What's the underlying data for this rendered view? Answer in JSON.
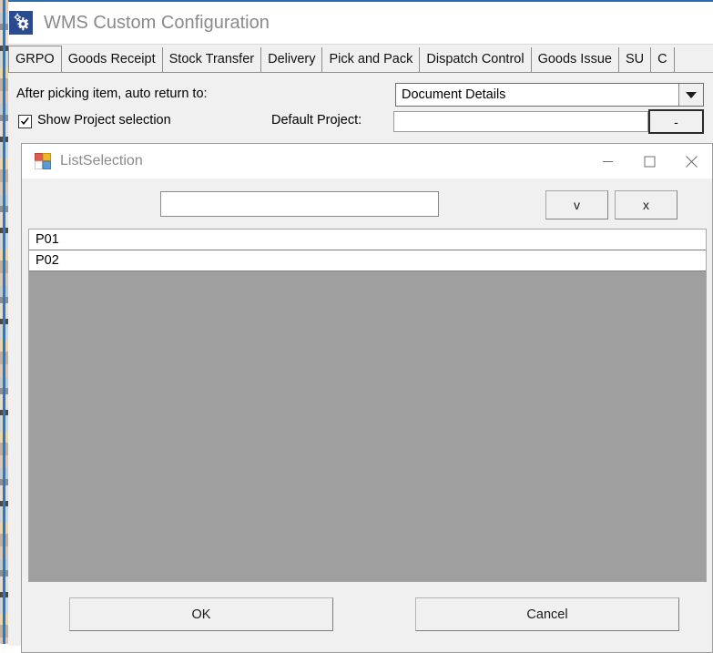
{
  "app": {
    "title": "WMS Custom Configuration",
    "icon": "gears-icon",
    "accent_color": "#2b4b8f",
    "title_color": "#8a8a8a",
    "top_border_color": "#2c6ca8"
  },
  "tabs": [
    {
      "label": "GRPO",
      "active": true
    },
    {
      "label": "Goods Receipt",
      "active": false
    },
    {
      "label": "Stock Transfer",
      "active": false
    },
    {
      "label": "Delivery",
      "active": false
    },
    {
      "label": "Pick and Pack",
      "active": false
    },
    {
      "label": "Dispatch Control",
      "active": false
    },
    {
      "label": "Goods Issue",
      "active": false
    },
    {
      "label": "SU",
      "active": false
    },
    {
      "label": "C",
      "active": false
    }
  ],
  "form": {
    "auto_return_label": "After picking item, auto return to:",
    "auto_return_value": "Document Details",
    "auto_return_options": [
      "Document Details"
    ],
    "show_project_label": "Show Project selection",
    "show_project_checked": true,
    "default_project_label": "Default Project:",
    "default_project_value": "",
    "default_project_placeholder": "",
    "default_project_button_label": "-",
    "hidden_row_text": ""
  },
  "dialog": {
    "title": "ListSelection",
    "icon": "color-grid-icon",
    "title_color": "#8b8b8b",
    "window_buttons": {
      "minimize": "minimize-icon",
      "maximize": "maximize-icon",
      "close": "close-icon"
    },
    "search_value": "",
    "search_placeholder": "",
    "accept_button_label": "v",
    "clear_button_label": "x",
    "list_background": "#9f9f9f",
    "items": [
      {
        "label": "P01"
      },
      {
        "label": "P02"
      }
    ],
    "ok_label": "OK",
    "cancel_label": "Cancel"
  }
}
